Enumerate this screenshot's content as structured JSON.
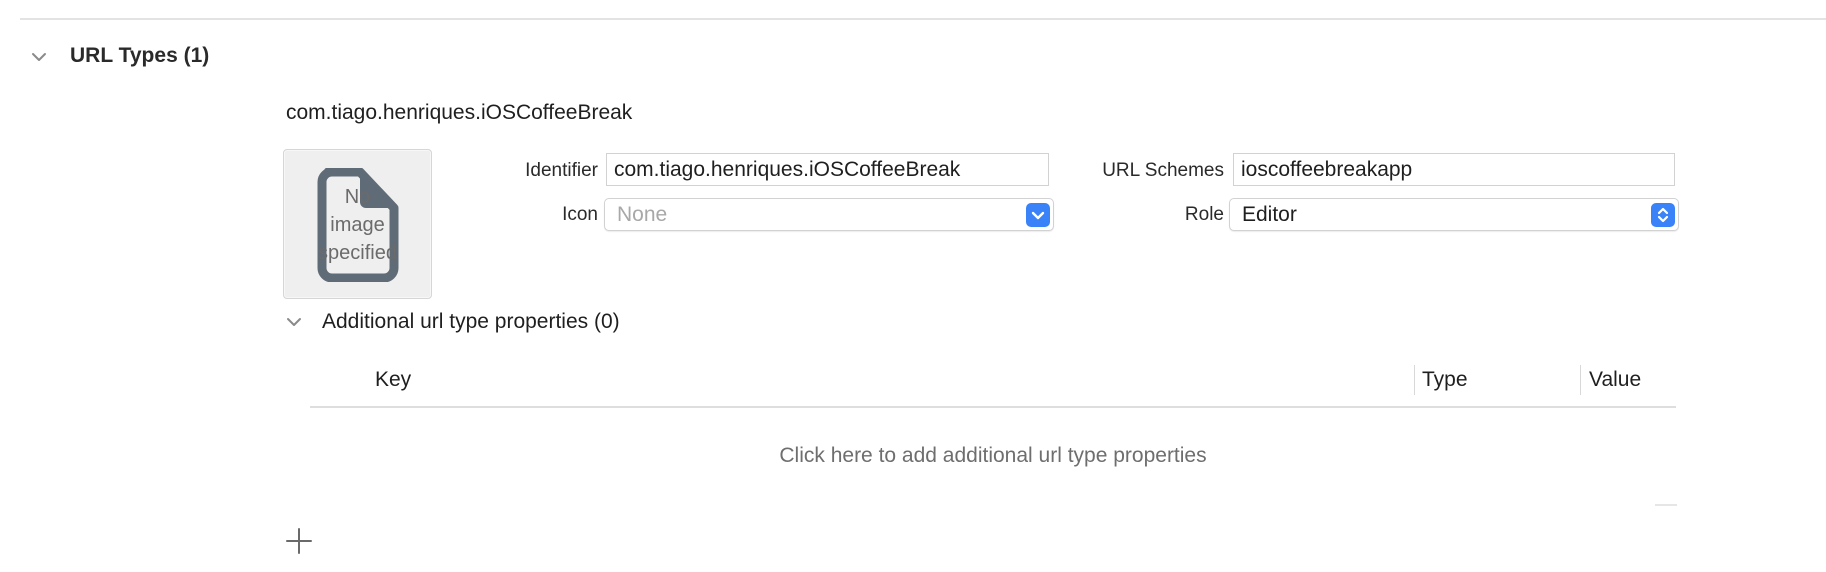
{
  "section": {
    "title": "URL Types (1)"
  },
  "url_type": {
    "name": "com.tiago.henriques.iOSCoffeeBreak",
    "image_placeholder": "No\nimage\nspecified",
    "identifier_label": "Identifier",
    "identifier_value": "com.tiago.henriques.iOSCoffeeBreak",
    "url_schemes_label": "URL Schemes",
    "url_schemes_value": "ioscoffeebreakapp",
    "icon_label": "Icon",
    "icon_value": "None",
    "role_label": "Role",
    "role_value": "Editor"
  },
  "additional": {
    "title": "Additional url type properties (0)",
    "columns": [
      "Key",
      "Type",
      "Value"
    ],
    "empty_hint": "Click here to add additional url type properties"
  },
  "icons": {
    "section_toggle": "chevron-down-icon",
    "document": "document-icon",
    "popup_arrows": "chevron-down-icon",
    "stepper_arrows": "up-down-chevron-icon",
    "add": "plus-icon"
  },
  "colors": {
    "accent": "#3a82f7",
    "placeholder_text": "#a8a8a8",
    "divider": "#e3e3e3"
  }
}
